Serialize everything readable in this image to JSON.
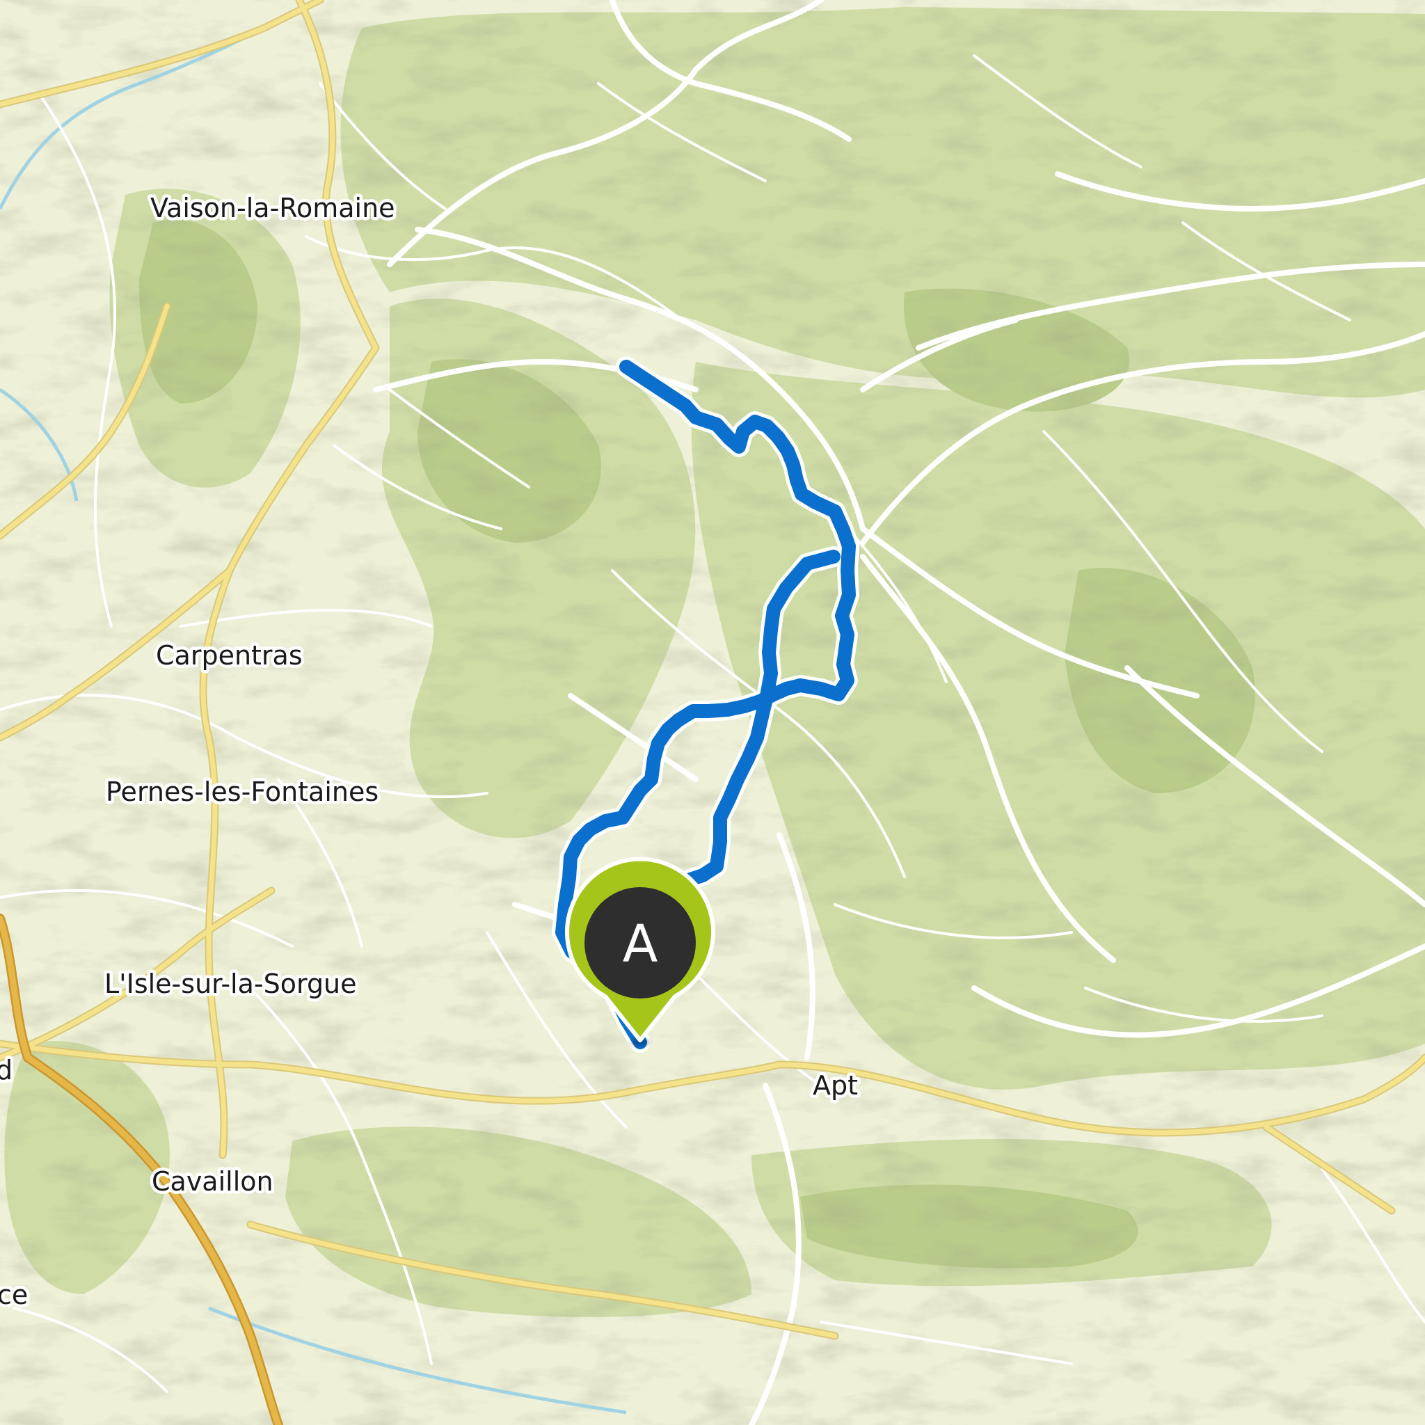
{
  "map": {
    "colors": {
      "background": "#eef0d8",
      "forest": "#cfdca6",
      "forest_dark": "#b9cc8a",
      "relief_shadow": "#8e9a72",
      "road": "#ffffff",
      "main_road": "#f2e288",
      "highway": "#e5b648",
      "river": "#9fd3e3",
      "route": "#0a6fcd",
      "route_outline": "#ffffff",
      "marker_ring": "#a6c51a",
      "marker_center": "#2e2e2e"
    },
    "towns": [
      {
        "label": "Vaison-la-Romaine"
      },
      {
        "label": "Carpentras"
      },
      {
        "label": "Pernes-les-Fontaines"
      },
      {
        "label": "L'Isle-sur-la-Sorgue"
      },
      {
        "label": "Apt"
      },
      {
        "label": "Cavaillon"
      },
      {
        "label": "d"
      },
      {
        "label": "ce"
      }
    ],
    "start_marker": {
      "letter": "A",
      "icon": "map-pin-icon"
    }
  }
}
